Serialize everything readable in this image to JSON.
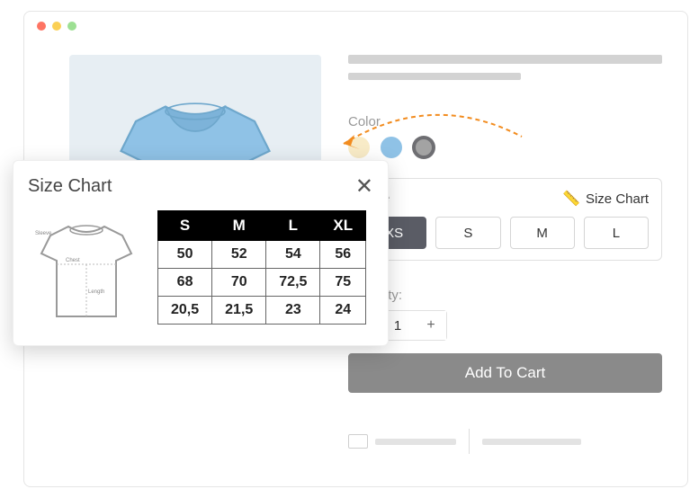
{
  "product": {
    "colorLabel": "Color",
    "colors": [
      "cream",
      "blue",
      "gray"
    ],
    "sizeTitle": "Size",
    "sizeChartLink": "Size Chart",
    "sizes": [
      "XS",
      "S",
      "M",
      "L"
    ],
    "selectedSize": "XS",
    "qtyLabel": "Quantity:",
    "qtyValue": "1",
    "qtyMinus": "-",
    "qtyPlus": "+",
    "cartBtn": "Add To Cart"
  },
  "popup": {
    "title": "Size Chart",
    "close": "✕",
    "diagramLabels": {
      "sleeve": "Sleeve",
      "chest": "Chest",
      "length": "Length"
    },
    "tableHeaders": [
      "S",
      "M",
      "L",
      "XL"
    ],
    "tableRows": [
      [
        "50",
        "52",
        "54",
        "56"
      ],
      [
        "68",
        "70",
        "72,5",
        "75"
      ],
      [
        "20,5",
        "21,5",
        "23",
        "24"
      ]
    ]
  }
}
